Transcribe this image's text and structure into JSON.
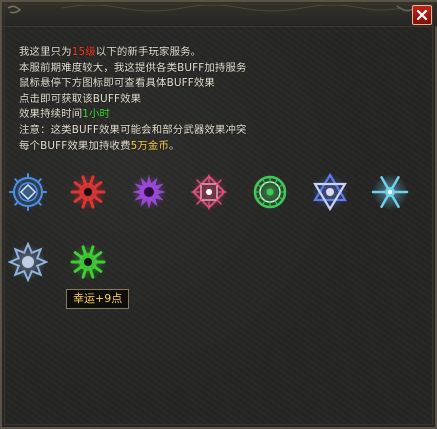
{
  "dialog": {
    "lines": [
      {
        "parts": [
          {
            "text": "我这里只为"
          },
          {
            "text": "1",
            "color": "red"
          },
          {
            "text": "5级",
            "color": "red"
          },
          {
            "text": "以下的新手玩家服务。"
          }
        ]
      },
      {
        "parts": [
          {
            "text": "本服前期难度较大，我这提供各类BUFF加持服务"
          }
        ]
      },
      {
        "parts": [
          {
            "text": "鼠标悬停下方图标即可查看具体BUFF效果"
          }
        ]
      },
      {
        "parts": [
          {
            "text": "点击即可获取该BUFF效果"
          }
        ]
      },
      {
        "parts": [
          {
            "text": "效果持续时间"
          },
          {
            "text": "1小时",
            "color": "green"
          }
        ]
      },
      {
        "parts": [
          {
            "text": "注意：这类BUFF效果可能会和部分武器效果冲突"
          }
        ]
      },
      {
        "parts": [
          {
            "text": "每个BUFF效果加持收费"
          },
          {
            "text": "5万金币",
            "color": "yellow"
          },
          {
            "text": "。"
          }
        ]
      }
    ]
  },
  "buff_icons": [
    {
      "name": "buff-icon-blue-rune",
      "color": "#4a90e8",
      "shape": "rune"
    },
    {
      "name": "buff-icon-red-gear",
      "color": "#e23434",
      "shape": "gear"
    },
    {
      "name": "buff-icon-purple-sun",
      "color": "#a04ae0",
      "shape": "sun"
    },
    {
      "name": "buff-icon-pink-sigil",
      "color": "#e04c78",
      "shape": "sigil"
    },
    {
      "name": "buff-icon-green-ring",
      "color": "#3ecb5a",
      "shape": "ring"
    },
    {
      "name": "buff-icon-blue-hexagram",
      "color": "#5a7df0",
      "shape": "hexagram"
    },
    {
      "name": "buff-icon-cyan-snowflake",
      "color": "#6fd3f0",
      "shape": "snowflake"
    },
    {
      "name": "buff-icon-silver-star",
      "color": "#8fb4e0",
      "shape": "star"
    },
    {
      "name": "buff-icon-green-gear",
      "color": "#3fce35",
      "shape": "gear"
    }
  ],
  "tooltip": {
    "text": "幸运+9点"
  },
  "colors": {
    "red": "#ff3b28",
    "green": "#3fe33f",
    "yellow": "#ffd34a"
  }
}
